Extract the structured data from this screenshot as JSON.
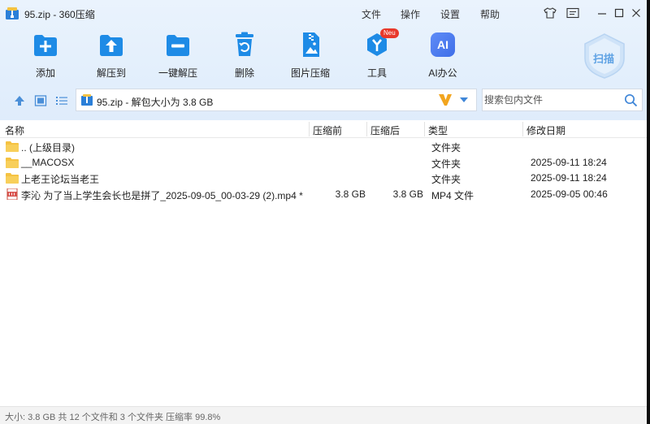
{
  "window": {
    "title": "95.zip - 360压缩"
  },
  "menu": {
    "file": "文件",
    "operate": "操作",
    "settings": "设置",
    "help": "帮助"
  },
  "toolbar": {
    "buttons": [
      {
        "label": "添加",
        "icon": "add-icon"
      },
      {
        "label": "解压到",
        "icon": "extract-to-icon"
      },
      {
        "label": "一键解压",
        "icon": "one-click-extract-icon"
      },
      {
        "label": "删除",
        "icon": "delete-icon"
      },
      {
        "label": "图片压缩",
        "icon": "image-compress-icon"
      },
      {
        "label": "工具",
        "icon": "tools-icon",
        "badge": "Neu"
      },
      {
        "label": "AI办公",
        "icon": "ai-office-icon",
        "glyph": "AI"
      }
    ],
    "scan": {
      "label": "扫描",
      "icon": "scan-shield-icon"
    }
  },
  "address": {
    "text": "95.zip - 解包大小为 3.8 GB"
  },
  "search": {
    "placeholder": "搜索包内文件"
  },
  "columns": {
    "name": "名称",
    "compressed_before": "压缩前",
    "compressed_after": "压缩后",
    "type": "类型",
    "modified": "修改日期"
  },
  "files": [
    {
      "name": ".. (上级目录)",
      "before": "",
      "after": "",
      "type": "文件夹",
      "date": "",
      "icon": "folder-icon"
    },
    {
      "name": "__MACOSX",
      "before": "",
      "after": "",
      "type": "文件夹",
      "date": "2025-09-11 18:24",
      "icon": "folder-icon"
    },
    {
      "name": "上老王论坛当老王",
      "before": "",
      "after": "",
      "type": "文件夹",
      "date": "2025-09-11 18:24",
      "icon": "folder-icon"
    },
    {
      "name": "李沁 为了当上学生会长也是拼了_2025-09-05_00-03-29 (2).mp4 *",
      "before": "3.8 GB",
      "after": "3.8 GB",
      "type": "MP4 文件",
      "date": "2025-09-05 00:46",
      "icon": "video-file-icon"
    }
  ],
  "status": {
    "text": "大小: 3.8 GB 共 12 个文件和 3 个文件夹 压缩率 99.8%"
  },
  "colors": {
    "accent": "#1e8be6",
    "toolbar_bg": "#e6f0fc",
    "folder": "#f5c242",
    "ai": "#4a7cf0",
    "badge": "#e8392b"
  }
}
